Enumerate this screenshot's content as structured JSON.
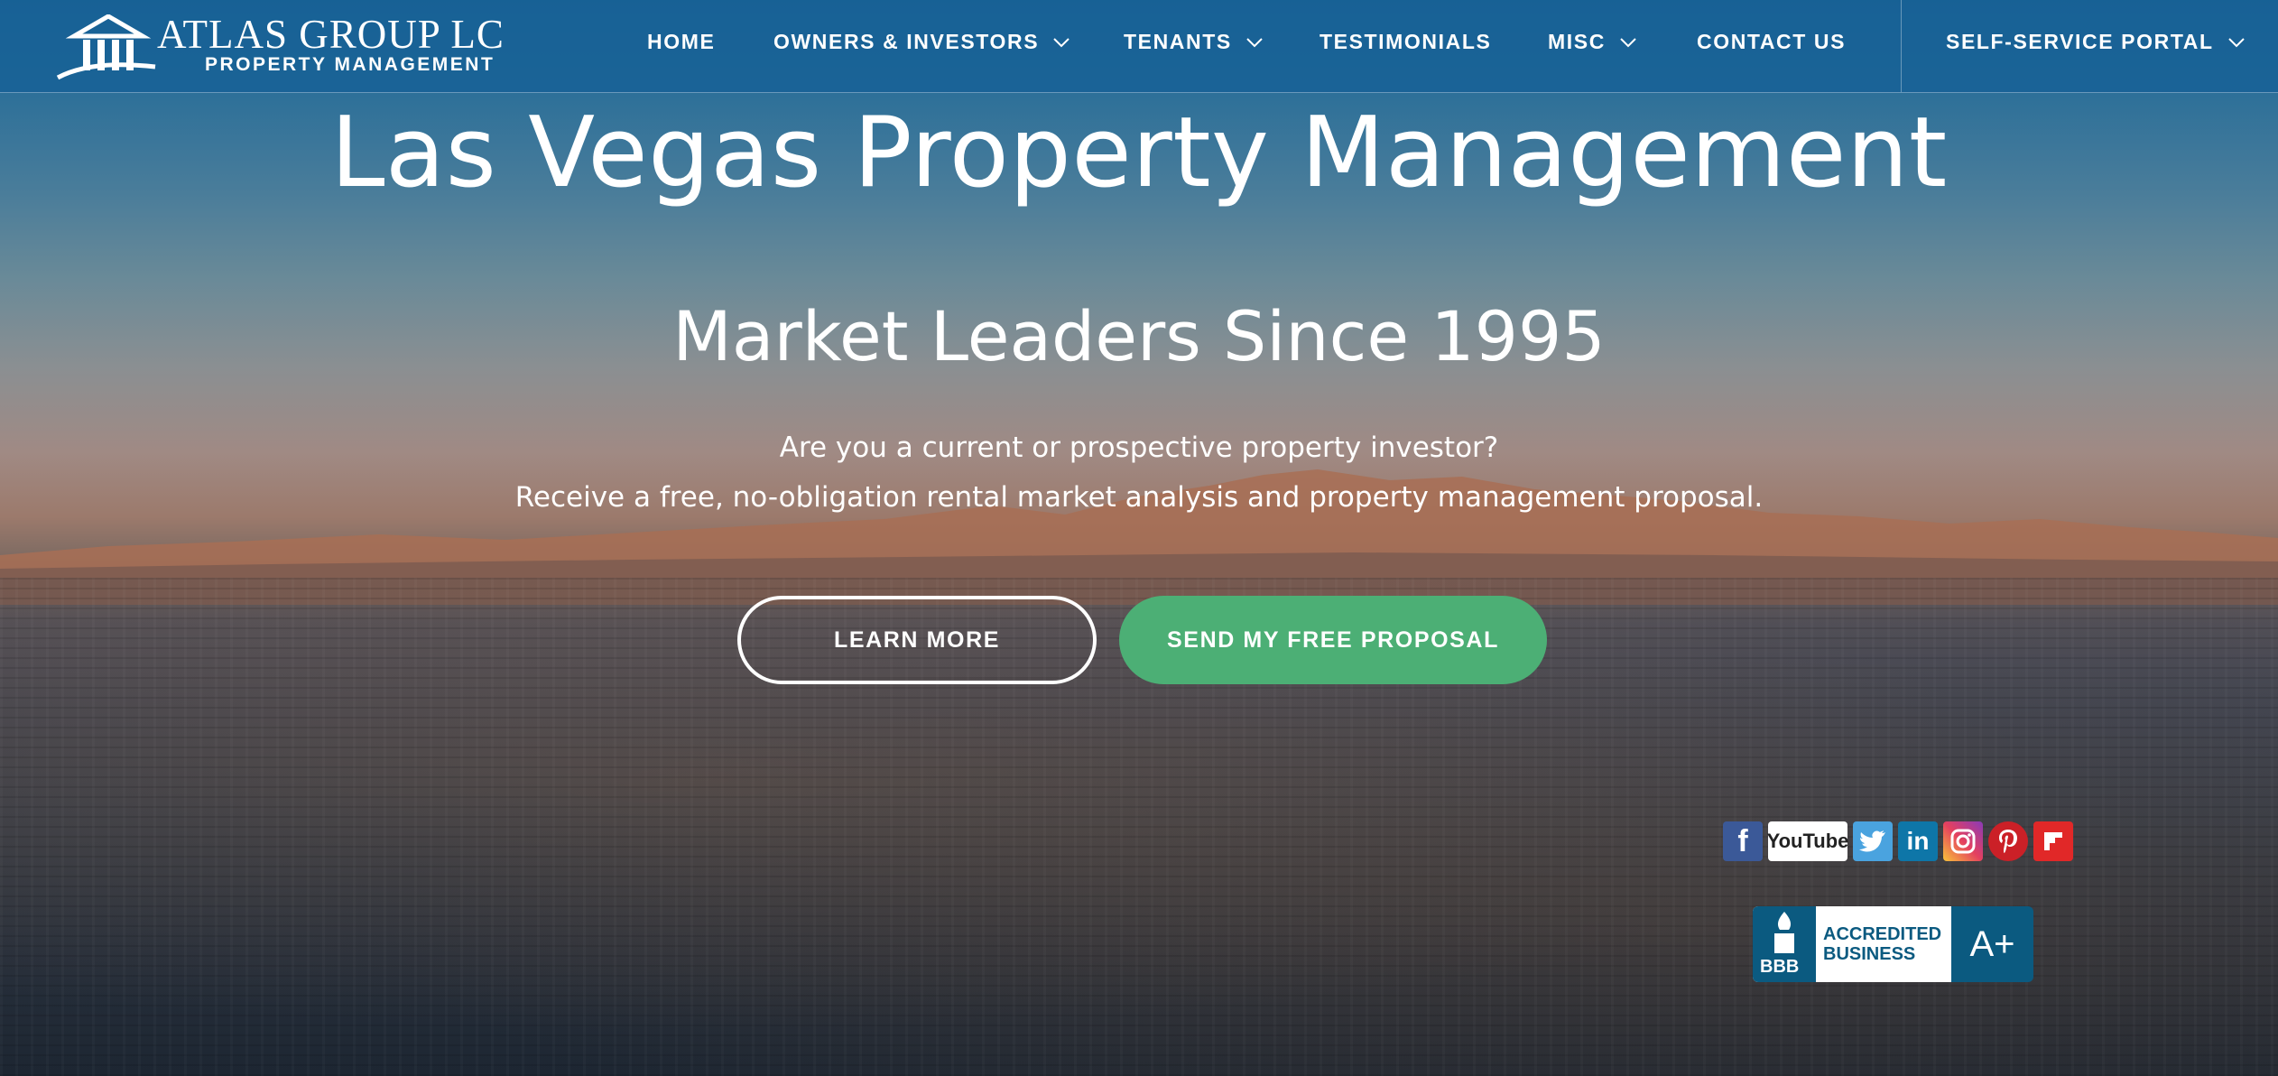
{
  "brand": {
    "title": "ATLAS GROUP LC",
    "subtitle": "PROPERTY MANAGEMENT"
  },
  "nav": {
    "items": [
      {
        "label": "HOME",
        "dropdown": false
      },
      {
        "label": "OWNERS & INVESTORS",
        "dropdown": true
      },
      {
        "label": "TENANTS",
        "dropdown": true
      },
      {
        "label": "TESTIMONIALS",
        "dropdown": false
      },
      {
        "label": "MISC",
        "dropdown": true
      },
      {
        "label": "CONTACT US",
        "dropdown": false
      }
    ],
    "portal": {
      "label": "SELF-SERVICE PORTAL",
      "dropdown": true
    }
  },
  "hero": {
    "heading": "Las Vegas Property Management",
    "subheading": "Market Leaders Since 1995",
    "line1": "Are you a current or prospective property investor?",
    "line2": "Receive a free, no-obligation rental market analysis and property management proposal.",
    "btn_learn": "LEARN MORE",
    "btn_proposal": "SEND MY FREE PROPOSAL"
  },
  "social": {
    "icons": [
      "facebook-icon",
      "youtube-icon",
      "twitter-icon",
      "linkedin-icon",
      "instagram-icon",
      "pinterest-icon",
      "flipboard-icon"
    ],
    "youtube_text": "YouTube",
    "linkedin_text": "in",
    "facebook_text": "f"
  },
  "bbb": {
    "logo_text": "BBB",
    "line1": "ACCREDITED",
    "line2": "BUSINESS",
    "rating": "A+"
  },
  "colors": {
    "nav_bg": "#1660a0",
    "button_green": "#4caf75",
    "bbb_blue": "#0b5a80"
  }
}
